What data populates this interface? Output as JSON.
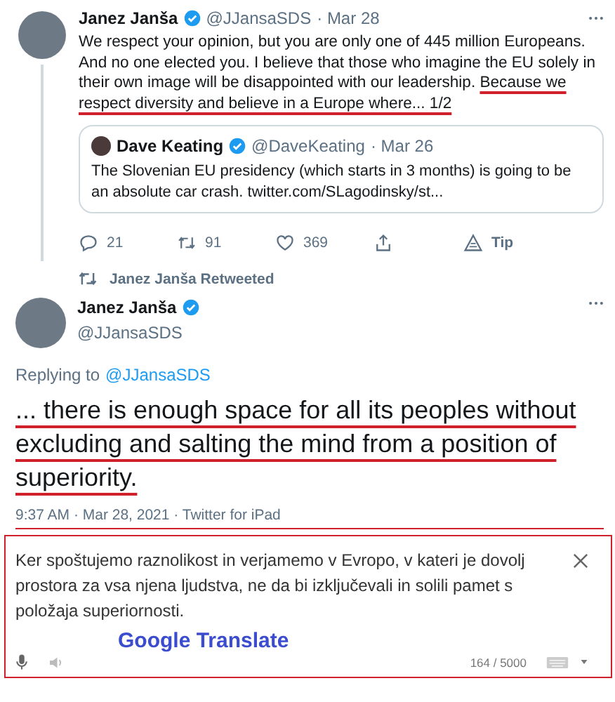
{
  "tweet": {
    "name": "Janez Janša",
    "verified": true,
    "handle": "@JJansaSDS",
    "date": "· Mar 28",
    "text": "We respect your opinion, but you are only one of 445 million Europeans. And no one elected you. I believe that those who imagine the EU solely in their own image will be disappointed with our leadership. ",
    "highlight": "Because we respect diversity and believe in a Europe where... 1/2",
    "quote": {
      "name": "Dave Keating",
      "verified": true,
      "handle": "@DaveKeating",
      "date": "· Mar 26",
      "text": "The Slovenian EU presidency (which starts in 3 months) is going to be an absolute car crash. twitter.com/SLagodinsky/st..."
    },
    "actions": [
      {
        "kind": "reply",
        "label": "21"
      },
      {
        "kind": "retweet",
        "label": "91"
      },
      {
        "kind": "like",
        "label": "369"
      },
      {
        "kind": "share"
      },
      {
        "kind": "tip",
        "label": "Tip"
      }
    ]
  },
  "retweet_label": "Janez Janša Retweeted",
  "reply_tweet": {
    "name": "Janez Janša",
    "verified": true,
    "handle": "@JJansaSDS",
    "replying_prefix": "Replying to",
    "replying_to": "@JJansaSDS",
    "text": "... there is enough space for all its peoples without excluding and salting the mind from a position of superiority.",
    "meta": "9:37 AM · Mar 28, 2021 · Twitter for iPad"
  },
  "translate": {
    "text": "Ker spoštujemo raznolikost in verjamemo v Evropo, v kateri je dovolj prostora za vsa njena ljudstva, ne da bi izključevali in solili pamet s položaja superiornosti.",
    "label": "Google Translate",
    "counter": "164 / 5000"
  }
}
